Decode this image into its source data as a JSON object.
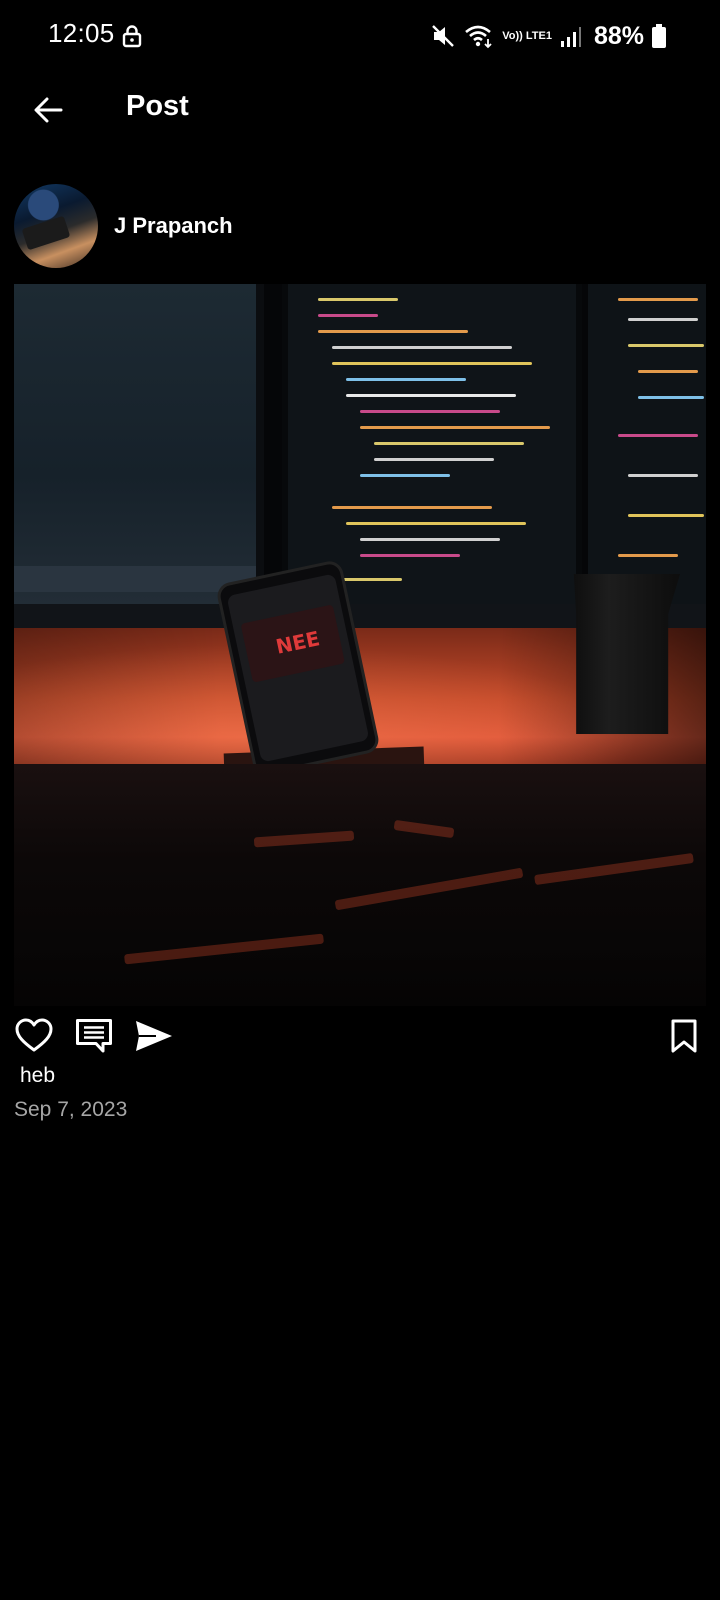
{
  "status_bar": {
    "time": "12:05",
    "network_label": "Vo)) LTE1",
    "battery": "88%"
  },
  "header": {
    "title": "Post"
  },
  "post": {
    "username": "J Prapanch",
    "caption": "heb",
    "date": "Sep 7, 2023",
    "image": {
      "phone_screen_text": "NEE"
    }
  },
  "icons": {
    "back": "arrow-left-icon",
    "like": "heart-icon",
    "comment": "comment-icon",
    "share": "send-icon",
    "save": "bookmark-icon"
  },
  "colors": {
    "background": "#000000",
    "text": "#ffffff",
    "secondary_text": "#a6a6a6"
  }
}
